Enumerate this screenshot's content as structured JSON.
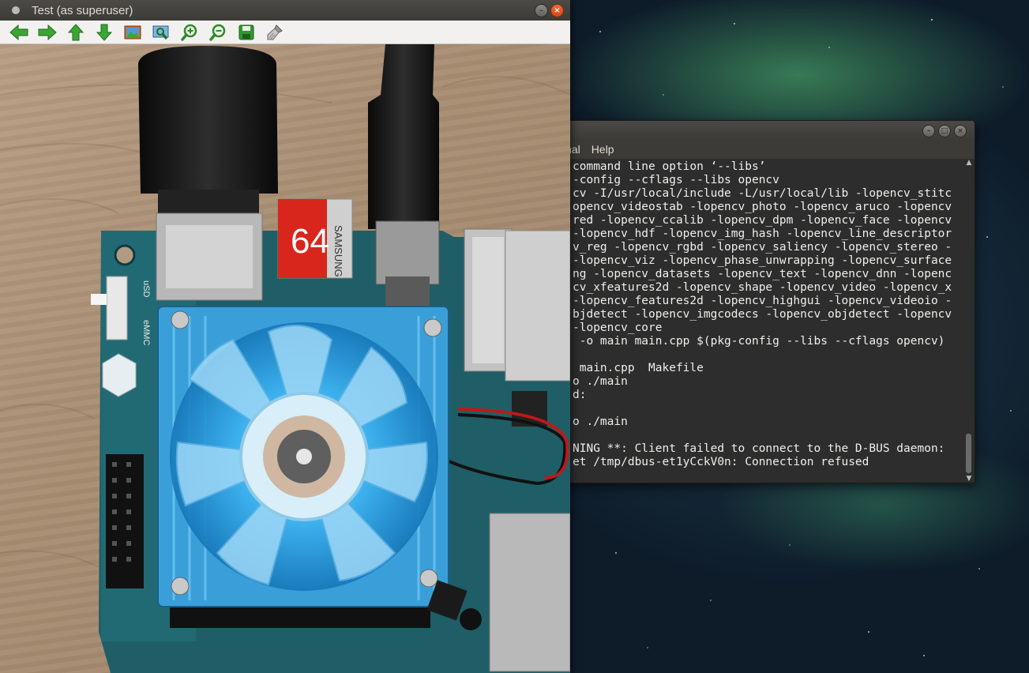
{
  "viewer": {
    "title": "Test (as superuser)",
    "toolbar": [
      {
        "name": "back-arrow-icon"
      },
      {
        "name": "forward-arrow-icon"
      },
      {
        "name": "up-arrow-icon"
      },
      {
        "name": "down-arrow-icon"
      },
      {
        "name": "image-icon"
      },
      {
        "name": "zoom-fit-icon"
      },
      {
        "name": "zoom-in-icon"
      },
      {
        "name": "zoom-out-icon"
      },
      {
        "name": "save-icon"
      },
      {
        "name": "brush-icon"
      }
    ],
    "photo": {
      "sd_card_text": "64",
      "sd_card_brand": "SAMSUNG",
      "board_labels": [
        "uSD",
        "eMMC"
      ]
    }
  },
  "terminal": {
    "menu": [
      "inal",
      "Help"
    ],
    "lines": [
      "command line option ‘--libs’",
      "-config --cflags --libs opencv",
      "cv -I/usr/local/include -L/usr/local/lib -lopencv_stitc",
      "opencv_videostab -lopencv_photo -lopencv_aruco -lopencv",
      "red -lopencv_ccalib -lopencv_dpm -lopencv_face -lopencv",
      "-lopencv_hdf -lopencv_img_hash -lopencv_line_descriptor",
      "v_reg -lopencv_rgbd -lopencv_saliency -lopencv_stereo -",
      "-lopencv_viz -lopencv_phase_unwrapping -lopencv_surface",
      "ng -lopencv_datasets -lopencv_text -lopencv_dnn -lopenc",
      "cv_xfeatures2d -lopencv_shape -lopencv_video -lopencv_x",
      "-lopencv_features2d -lopencv_highgui -lopencv_videoio -",
      "bjdetect -lopencv_imgcodecs -lopencv_objdetect -lopencv",
      "-lopencv_core",
      " -o main main.cpp $(pkg-config --libs --cflags opencv)",
      "",
      " main.cpp  Makefile",
      "o ./main",
      "d:",
      "",
      "o ./main",
      "",
      "NING **: Client failed to connect to the D-BUS daemon:",
      "et /tmp/dbus-et1yCckV0n: Connection refused"
    ]
  },
  "colors": {
    "titlebar": "#3c3b37",
    "close": "#e95420",
    "toolbar_bg": "#f2f1f0",
    "terminal_bg": "#2d2d2d",
    "icon_green": "#2f9a2c"
  }
}
